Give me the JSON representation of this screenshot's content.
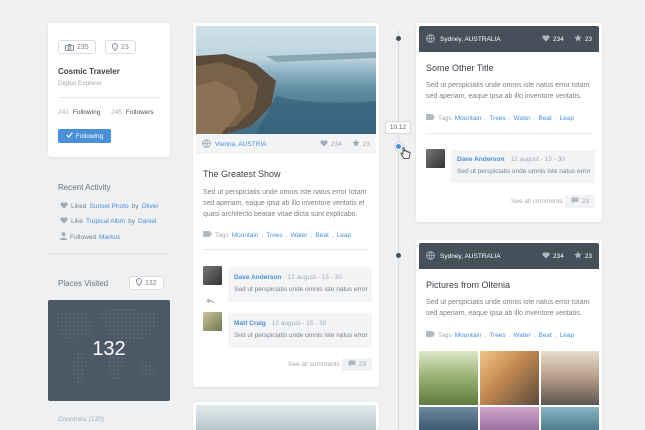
{
  "profile": {
    "photos_count": "235",
    "places_count": "23",
    "name": "Cosmic Traveler",
    "subtitle": "Digital Explorer",
    "following_count": "241",
    "following_label": "Following",
    "followers_count": "245",
    "followers_label": "Followers",
    "follow_button": "Following"
  },
  "activity": {
    "title": "Recent Activity",
    "items": [
      {
        "verb": "Liked",
        "object": "Sunset Photo",
        "by": "by",
        "user": "Oliver"
      },
      {
        "verb": "Like",
        "object": "Tropical Albm",
        "by": "by",
        "user": "Daniel"
      },
      {
        "verb": "Followed",
        "object": "Markus"
      }
    ]
  },
  "places": {
    "title": "Places Visited",
    "count_badge": "132",
    "map_number": "132",
    "countries_label": "Countries",
    "countries_count": "(120)"
  },
  "timeline": {
    "date_label": "10.12"
  },
  "post1": {
    "location": "Vienna, AUSTRIA",
    "likes": "234",
    "stars": "23",
    "title": "The Greatest Show",
    "body": "Sed ut perspiciatis unde omnis iste natus error totam sed aperiam, eaque ipsa ab illo inventore veritatis et quasi architecto beatae vitae dicta sunt explicabo.",
    "tags_label": "Tags",
    "tags": [
      "Mountain",
      "Trees",
      "Water",
      "Beat",
      "Leap"
    ],
    "comments": [
      {
        "author": "Dave Anderson",
        "time": "12 august - 15 - 30",
        "text": "Sed ut perspiciatis unde omnis iste natus error"
      },
      {
        "author": "Matt Craig",
        "time": "12 august - 15 - 30",
        "text": "Sed ut perspiciatis unde omnis iste natus error"
      }
    ],
    "see_all": "See all comments",
    "comment_count": "23"
  },
  "post2": {
    "location": "Sydney, AUSTRALIA",
    "likes": "234",
    "stars": "23",
    "title": "Some Other Title",
    "body": "Sed ut perspiciatis unde omnis iste natus error totam sed aperiam, eaque ipsa ab illo inventore veritatis.",
    "tags_label": "Tags",
    "tags": [
      "Mountain",
      "Trees",
      "Water",
      "Beat",
      "Leap"
    ],
    "comment": {
      "author": "Dave Anderson",
      "time": "12 august - 15 - 30",
      "text": "Sed ut perspiciatis unde omnis iste natus error"
    },
    "see_all": "See all comments",
    "comment_count": "23"
  },
  "post3": {
    "location": "Sydney, AUSTRALIA",
    "likes": "234",
    "stars": "23",
    "title": "Pictures from Oltenia",
    "body": "Sed ut perspiciatis unde omnis iste natus error totam sed aperiam, eaque ipsa ab illo inventore veritatis.",
    "tags_label": "Tags",
    "tags": [
      "Mountain",
      "Trees",
      "Water",
      "Beat",
      "Leap"
    ]
  },
  "colors": {
    "accent": "#4a90d9",
    "dark_header": "#47505a",
    "background": "#eef0f2",
    "map": "#4d5866"
  }
}
